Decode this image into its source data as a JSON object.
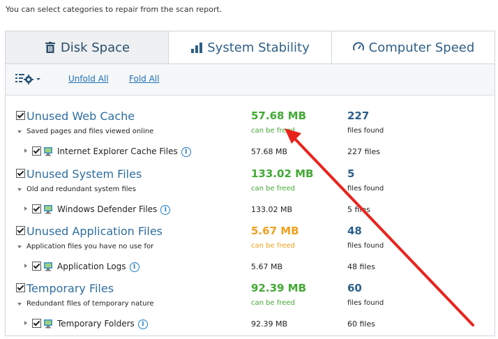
{
  "header": {
    "text": "You can select categories to repair from the scan report."
  },
  "tabs": [
    {
      "label": "Disk Space",
      "icon": "trash-icon",
      "active": true
    },
    {
      "label": "System Stability",
      "icon": "bar-chart-icon",
      "active": false
    },
    {
      "label": "Computer Speed",
      "icon": "speedometer-icon",
      "active": false
    }
  ],
  "toolbar": {
    "unfold_label": "Unfold All",
    "fold_label": "Fold All",
    "settings_icon": "settings-dropdown-icon"
  },
  "categories": [
    {
      "title": "Unused Web Cache",
      "desc": "Saved pages and files viewed online",
      "size": "57.68 MB",
      "size_sub": "can be freed",
      "size_color": "#43a935",
      "count": "227",
      "count_sub": "files found",
      "item": {
        "label": "Internet Explorer Cache Files",
        "size": "57.68 MB",
        "count": "227 files"
      }
    },
    {
      "title": "Unused System Files",
      "desc": "Old and redundant system files",
      "size": "133.02 MB",
      "size_sub": "can be freed",
      "size_color": "#43a935",
      "count": "5",
      "count_sub": "files found",
      "item": {
        "label": "Windows Defender Files",
        "size": "133.02 MB",
        "count": "5 files"
      }
    },
    {
      "title": "Unused Application Files",
      "desc": "Application files you have no use for",
      "size": "5.67 MB",
      "size_sub": "can be freed",
      "size_color": "#f0a020",
      "count": "48",
      "count_sub": "files found",
      "item": {
        "label": "Application Logs",
        "size": "5.67 MB",
        "count": "48 files"
      }
    },
    {
      "title": "Temporary Files",
      "desc": "Redundant files of temporary nature",
      "size": "92.39 MB",
      "size_sub": "can be freed",
      "size_color": "#43a935",
      "count": "60",
      "count_sub": "files found",
      "item": {
        "label": "Temporary Folders",
        "size": "92.39 MB",
        "count": "60 files"
      }
    }
  ],
  "annotation": {
    "color": "#e8231c"
  }
}
